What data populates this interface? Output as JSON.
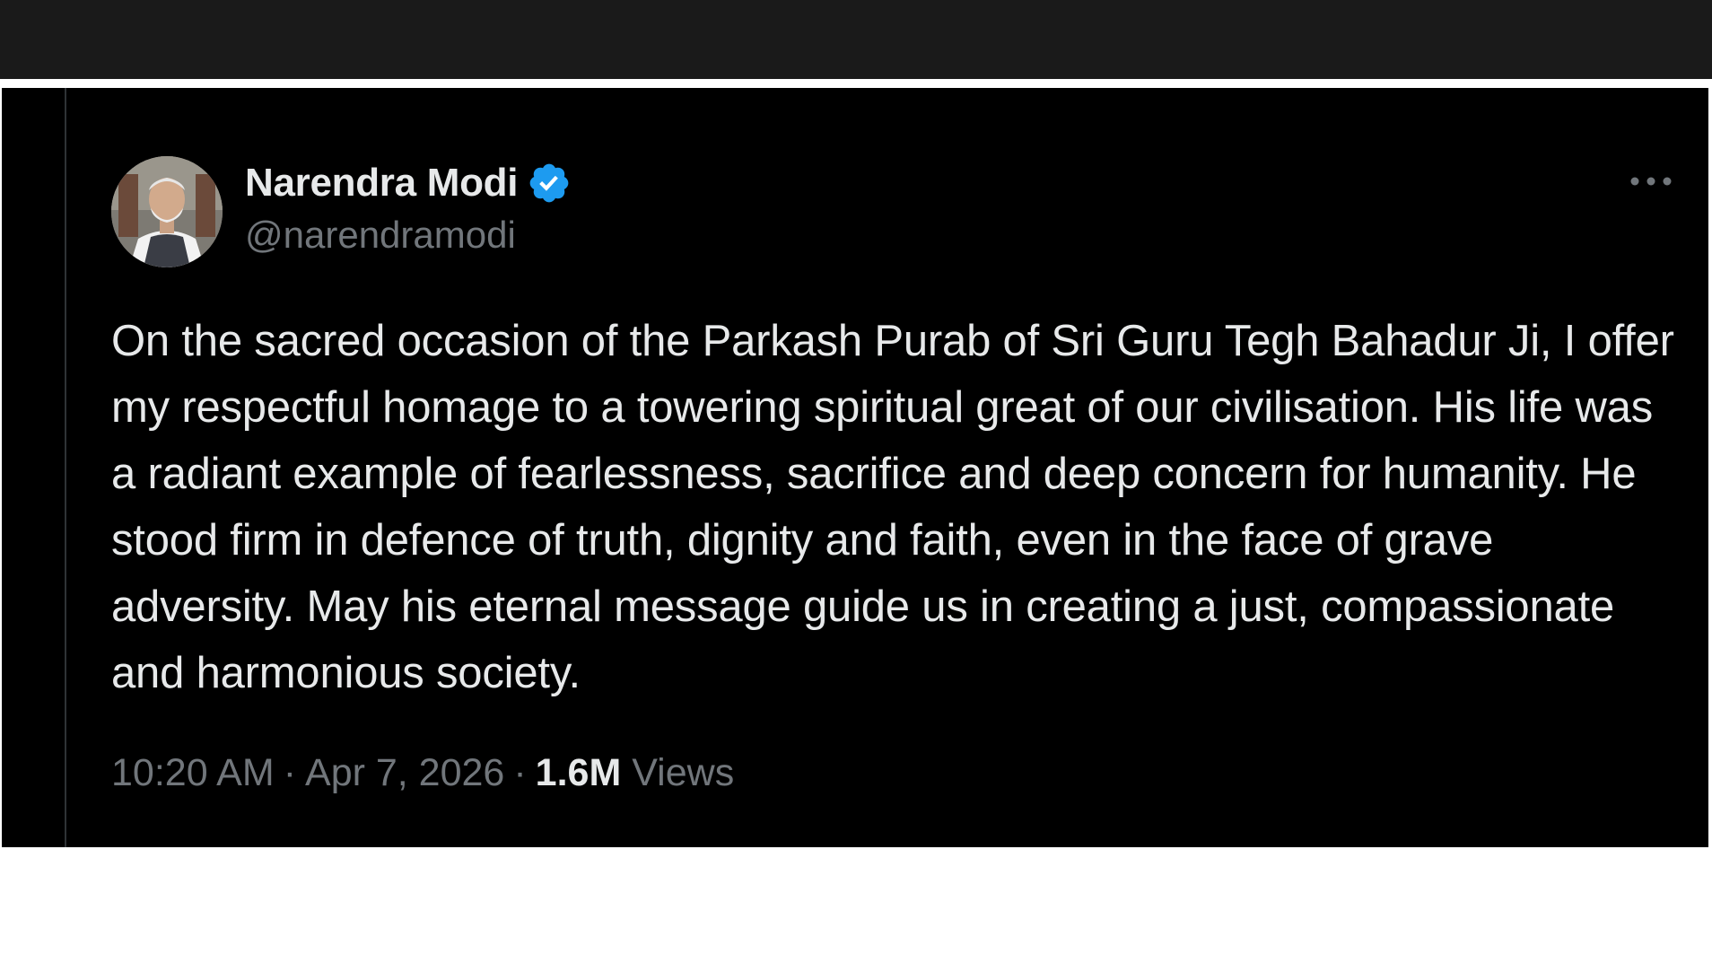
{
  "tweet": {
    "author": {
      "display_name": "Narendra Modi",
      "handle": "@narendramodi",
      "verified": true,
      "verified_color": "#1d9bf0"
    },
    "text": "On the sacred occasion of the Parkash Purab of Sri Guru Tegh Bahadur Ji, I offer my respectful homage to a towering spiritual great of our civilisation. His life was a radiant example of fearlessness, sacrifice and deep concern for humanity. He stood firm in defence of truth, dignity and faith, even in the face of grave adversity. May his eternal message guide us in creating a just, compassionate and harmonious society.",
    "time": "10:20 AM",
    "separator": "·",
    "date": "Apr 7, 2026",
    "views_count": "1.6M",
    "views_label": "Views"
  },
  "icons": {
    "more": "more-horizontal-icon",
    "verified": "verified-badge-icon",
    "avatar": "profile-avatar"
  },
  "colors": {
    "background": "#000000",
    "top_bar": "#1a1a1a",
    "primary_text": "#e7e9ea",
    "secondary_text": "#71767b"
  }
}
